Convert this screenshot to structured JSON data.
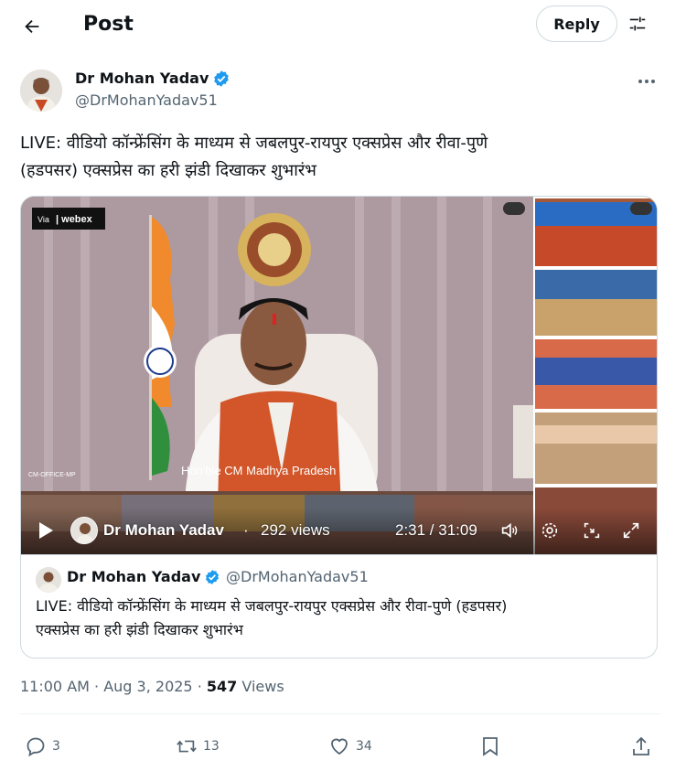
{
  "header": {
    "title": "Post",
    "reply_label": "Reply"
  },
  "author": {
    "name": "Dr Mohan Yadav",
    "handle": "@DrMohanYadav51"
  },
  "post": {
    "text_line1": "LIVE: वीडियो कॉन्फ्रेंसिंग के माध्यम से जबलपुर-रायपुर एक्सप्रेस और रीवा-पुणे",
    "text_line2": "(हडपसर) एक्सप्रेस का हरी झंडी दिखाकर शुभारंभ"
  },
  "video": {
    "source_badge": "Via | webex",
    "caption": "Hon'ble CM Madhya Pradesh",
    "channel_name": "Dr Mohan Yadav",
    "separator": "·",
    "views": "292 views",
    "time": "2:31 / 31:09",
    "icons": [
      "play-icon",
      "volume-icon",
      "settings-icon",
      "miniplayer-icon",
      "fullscreen-icon"
    ]
  },
  "quote": {
    "name": "Dr Mohan Yadav",
    "handle": "@DrMohanYadav51",
    "text_line1": "LIVE: वीडियो कॉन्फ्रेंसिंग के माध्यम से जबलपुर-रायपुर एक्सप्रेस और रीवा-पुणे (हडपसर)",
    "text_line2": "एक्सप्रेस का हरी झंडी दिखाकर शुभारंभ"
  },
  "meta": {
    "timestamp": "11:00 AM · Aug 3, 2025 · ",
    "views_count": "547",
    "views_label": " Views"
  },
  "actions": {
    "replies": "3",
    "reposts": "13",
    "likes": "34"
  },
  "colors": {
    "verified": "#1d9bf0",
    "text_secondary": "#536471",
    "border": "#cfd9de"
  }
}
